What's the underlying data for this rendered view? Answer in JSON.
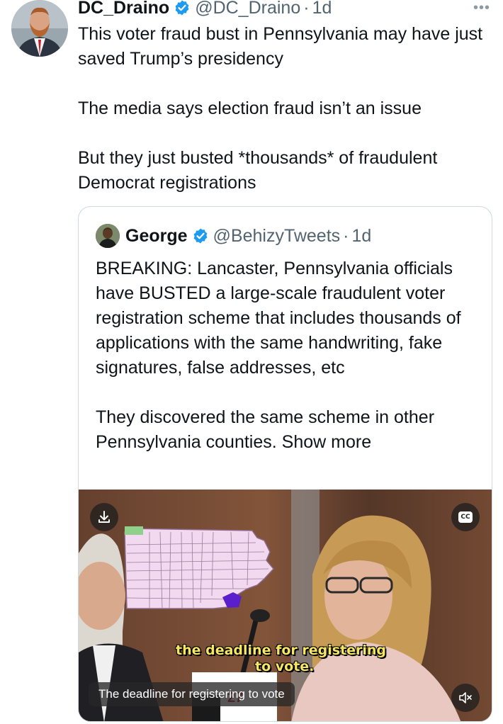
{
  "tweet": {
    "author_name": "DC_Draino",
    "handle": "@DC_Draino",
    "separator": "·",
    "time": "1d",
    "more_icon": "more-icon",
    "text": "This voter fraud bust in Pennsylvania may have just saved Trump’s presidency\n\nThe media says election fraud isn’t an issue\n\nBut they just busted *thousands* of fraudulent Democrat registrations"
  },
  "quote": {
    "author_name": "George",
    "handle": "@BehizyTweets",
    "separator": "·",
    "time": "1d",
    "text": "BREAKING: Lancaster, Pennsylvania officials have BUSTED a large-scale fraudulent voter registration scheme that includes thousands of applications with the same handwriting, fake signatures, false addresses, etc\n\nThey discovered the same scheme in other Pennsylvania counties. ",
    "show_more": "Show more"
  },
  "video": {
    "burned_caption_line1": "the deadline for registering",
    "burned_caption_line2": "to vote.",
    "cc_caption": "The deadline for registering to vote",
    "cc_label": "CC",
    "icons": [
      "download-icon",
      "closed-captions-icon",
      "muted-speaker-icon"
    ]
  },
  "colors": {
    "verified": "#1d9bf0",
    "text": "#0f1419",
    "secondary": "#536471",
    "border": "#cfd9de",
    "map_fill": "#f2d9f0",
    "map_highlight": "#5b1ecc"
  }
}
